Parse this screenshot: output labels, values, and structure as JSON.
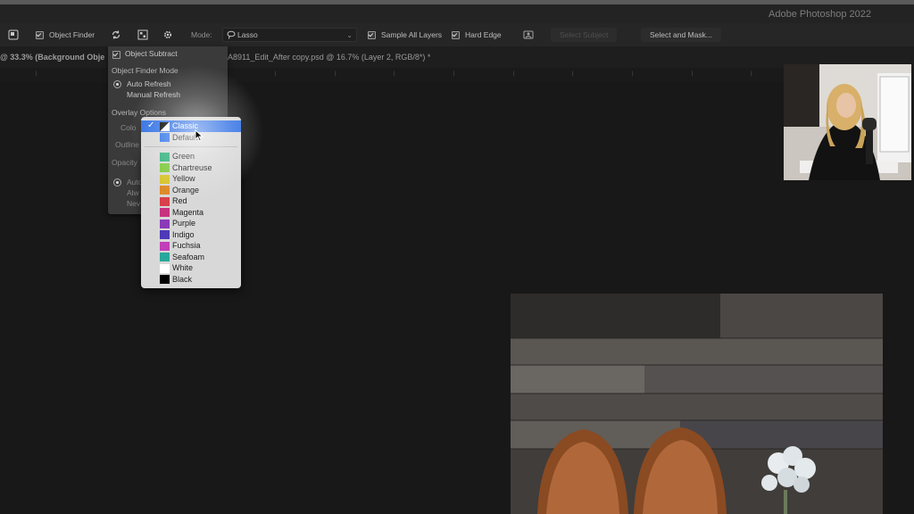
{
  "app": {
    "title": "Adobe Photoshop 2022"
  },
  "options_bar": {
    "object_finder_label": "Object Finder",
    "object_finder_checked": true,
    "mode_label": "Mode:",
    "mode_value": "Lasso",
    "sample_all_layers_label": "Sample All Layers",
    "sample_all_layers_checked": true,
    "hard_edge_label": "Hard Edge",
    "hard_edge_checked": true,
    "select_subject_label": "Select Subject",
    "select_and_mask_label": "Select and Mask..."
  },
  "tabs": {
    "tab1": "@ 33.3% (Background Obje",
    "tab2": "A8911_Edit_After copy.psd @ 16.7% (Layer 2, RGB/8*) *"
  },
  "settings_panel": {
    "object_subtract_label": "Object Subtract",
    "mode_heading": "Object Finder Mode",
    "auto_refresh": "Auto Refresh",
    "manual_refresh": "Manual Refresh",
    "overlay_heading": "Overlay Options",
    "color_label": "Colo",
    "outline_label": "Outline",
    "opacity_label": "Opacity",
    "r1": "Auto",
    "r2": "Alw",
    "r3": "Nev"
  },
  "color_menu": {
    "items": [
      {
        "label": "Classic",
        "selected": true
      },
      {
        "label": "Default"
      },
      {
        "label": "Green",
        "color": "#2fb07a"
      },
      {
        "label": "Chartreuse",
        "color": "#7cc83c"
      },
      {
        "label": "Yellow",
        "color": "#d7c32b"
      },
      {
        "label": "Orange",
        "color": "#dd8a2a"
      },
      {
        "label": "Red",
        "color": "#d8404a"
      },
      {
        "label": "Magenta",
        "color": "#c8337f"
      },
      {
        "label": "Purple",
        "color": "#8a3ab8"
      },
      {
        "label": "Indigo",
        "color": "#4e3ab7"
      },
      {
        "label": "Fuchsia",
        "color": "#c23fb8"
      },
      {
        "label": "Seafoam",
        "color": "#2aa79b"
      },
      {
        "label": "White",
        "color": "#ffffff"
      },
      {
        "label": "Black",
        "color": "#000000"
      }
    ]
  },
  "colors": {
    "accent": "#2f6fe4",
    "default_swatch": "#2f72e8"
  }
}
